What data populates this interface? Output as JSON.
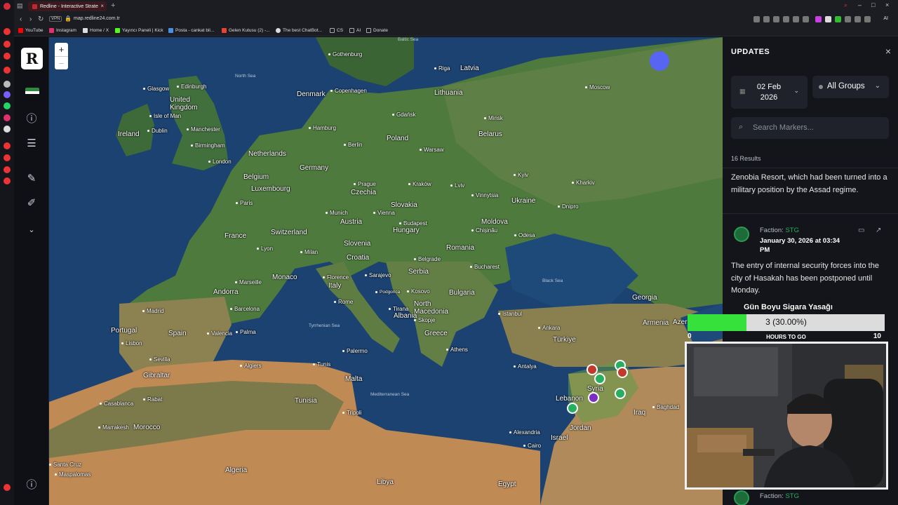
{
  "browser": {
    "tab_title": "Redline - Interactive Strate",
    "url": "map.redline24.com.tr",
    "vpn_label": "VPN",
    "ai_label": "AI",
    "bookmarks": [
      "YouTube",
      "Instagram",
      "Home / X",
      "Yayıncı Paneli | Kick",
      "Posta - cankat bil...",
      "Gelen Kutusu (2) -...",
      "The best ChatBot...",
      "CS",
      "AI",
      "Donate"
    ]
  },
  "app": {
    "logo_letter": "R",
    "toolbar_icons": [
      "info-icon",
      "sliders-icon",
      "ruler-icon",
      "pen-icon",
      "chevron-down-icon",
      "info-icon"
    ]
  },
  "map": {
    "zoom_in": "+",
    "zoom_out": "−",
    "seas": [
      "Baltic Sea",
      "North Sea",
      "Black Sea",
      "Tyrrhenian Sea",
      "Mediterranean Sea"
    ],
    "countries": [
      "Ireland",
      "United Kingdom",
      "Denmark",
      "Lithuania",
      "Latvia",
      "Belarus",
      "Poland",
      "Germany",
      "Netherlands",
      "Belgium",
      "Luxembourg",
      "France",
      "Switzerland",
      "Czechia",
      "Slovakia",
      "Austria",
      "Hungary",
      "Ukraine",
      "Moldova",
      "Romania",
      "Slovenia",
      "Croatia",
      "Serbia",
      "Bulgaria",
      "Italy",
      "Kosovo",
      "North Macedonia",
      "Albania",
      "Greece",
      "Türkiye",
      "Georgia",
      "Armenia",
      "Azer",
      "Syria",
      "Lebanon",
      "Iraq",
      "Israel",
      "Jordan",
      "Egypt",
      "Libya",
      "Tunisia",
      "Algeria",
      "Morocco",
      "Spain",
      "Portugal",
      "Andorra",
      "Monaco",
      "Malta",
      "Gibraltar"
    ],
    "cities": [
      "Gothenburg",
      "Riga",
      "Edinburgh",
      "Glasgow",
      "Isle of Man",
      "Dublin",
      "Manchester",
      "Birmingham",
      "London",
      "Copenhagen",
      "Hamburg",
      "Gdańsk",
      "Minsk",
      "Moscow",
      "Berlin",
      "Warsaw",
      "Kyiv",
      "Kharkiv",
      "Prague",
      "Kraków",
      "Lviv",
      "Vinnytsia",
      "Dnipro",
      "Paris",
      "Munich",
      "Vienna",
      "Budapest",
      "Chișinău",
      "Odesa",
      "Lyon",
      "Milan",
      "Florence",
      "Marseille",
      "Barcelona",
      "Rome",
      "Sarajevo",
      "Belgrade",
      "Bucharest",
      "Podgorica",
      "Tirana",
      "Skopje",
      "Istanbul",
      "Ankara",
      "Athens",
      "Antalya",
      "Madrid",
      "Valencia",
      "Palma",
      "Lisbon",
      "Sevilla",
      "Algiers",
      "Tunis",
      "Palermo",
      "Rabat",
      "Casablanca",
      "Marrakesh",
      "Tripoli",
      "Alexandria",
      "Cairo",
      "Baghdad",
      "Santa Cruz",
      "Maspalomas"
    ]
  },
  "panel": {
    "title": "UPDATES",
    "date_filter": "02 Feb 2026",
    "group_filter": "All Groups",
    "search_placeholder": "Search Markers...",
    "results_count": "16 Results",
    "entry_top_text": "Zenobia Resort, which had been turned into a military position by the Assad regime.",
    "entry": {
      "faction_label": "Faction:",
      "faction_value": "STG",
      "date": "January 30, 2026 at 03:34 PM",
      "text": "The entry of internal security forces into the city of Hasakah has been postponed until Monday."
    },
    "bottom_entry": {
      "faction_label": "Faction:",
      "faction_value": "STG"
    }
  },
  "overlay": {
    "goal_title": "Gün Boyu Sigara Yasağı",
    "goal_value": "3 (30.00%)",
    "goal_progress": 0.3,
    "goal_min": "0",
    "goal_max": "10",
    "goal_sub": "HOURS TO GO"
  },
  "colors": {
    "accent_green": "#27ae60",
    "goal_fill": "#35e13a",
    "brand_red": "#c0272d",
    "discord": "#5865f2"
  }
}
